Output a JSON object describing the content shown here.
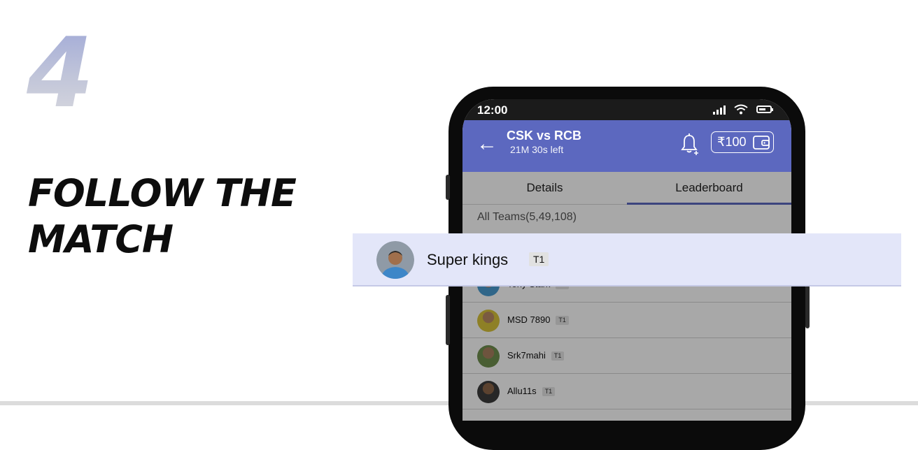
{
  "promo": {
    "step_number": "4",
    "headline_line1": "FOLLOW THE",
    "headline_line2": "MATCH"
  },
  "status_bar": {
    "time": "12:00"
  },
  "header": {
    "match_title": "CSK vs RCB",
    "time_left": "21M 30s left",
    "wallet_amount": "₹100"
  },
  "tabs": [
    {
      "label": "Details",
      "active": false
    },
    {
      "label": "Leaderboard",
      "active": true
    }
  ],
  "leaderboard": {
    "all_teams_label": "All Teams(5,49,108)",
    "highlighted_entry": {
      "name": "Super kings",
      "team": "T1"
    },
    "entries": [
      {
        "name": "Tony Stark",
        "team": "T1"
      },
      {
        "name": "MSD 7890",
        "team": "T1"
      },
      {
        "name": "Srk7mahi",
        "team": "T1"
      },
      {
        "name": "Allu11s",
        "team": "T1"
      }
    ]
  },
  "colors": {
    "header_bg": "#5c68bf",
    "highlight_bg": "#e3e6f9",
    "accent": "#5c68bf"
  }
}
